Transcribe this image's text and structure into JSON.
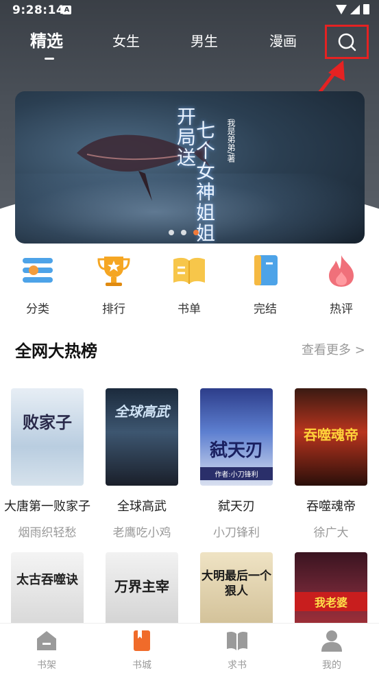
{
  "status": {
    "time": "9:28:14",
    "app_badge": "A"
  },
  "top_tabs": [
    {
      "label": "精选",
      "active": true
    },
    {
      "label": "女生",
      "active": false
    },
    {
      "label": "男生",
      "active": false
    },
    {
      "label": "漫画",
      "active": false
    }
  ],
  "banner": {
    "title_line1": "开局送",
    "title_line2": "七个女神姐姐",
    "author": "我是弟弟/著",
    "dot_count": 3,
    "active_dot": 2
  },
  "categories": [
    {
      "label": "分类",
      "icon": "category-icon"
    },
    {
      "label": "排行",
      "icon": "trophy-icon"
    },
    {
      "label": "书单",
      "icon": "booklist-icon"
    },
    {
      "label": "完结",
      "icon": "finished-book-icon"
    },
    {
      "label": "热评",
      "icon": "flame-icon"
    }
  ],
  "section": {
    "title": "全网大热榜",
    "more": "查看更多 >"
  },
  "books_row1": [
    {
      "title": "大唐第一败家子",
      "author": "烟雨织轻愁",
      "cover_text": "败家子"
    },
    {
      "title": "全球高武",
      "author": "老鹰吃小鸡",
      "cover_text": "全球高武"
    },
    {
      "title": "弑天刃",
      "author": "小刀锋利",
      "cover_text": "弑天刃",
      "cover_sub": "作者:小刀锋利"
    },
    {
      "title": "吞噬魂帝",
      "author": "徐广大",
      "cover_text": "吞噬魂帝"
    }
  ],
  "books_row2": [
    {
      "cover_text": "太古吞噬诀"
    },
    {
      "cover_text": "万界主宰"
    },
    {
      "cover_text": "大明最后一个狠人"
    },
    {
      "cover_text": "我老婆"
    }
  ],
  "bottom_nav": [
    {
      "label": "书架",
      "icon": "bookshelf-icon",
      "active": false
    },
    {
      "label": "书城",
      "icon": "bookstore-icon",
      "active": true
    },
    {
      "label": "求书",
      "icon": "request-book-icon",
      "active": false
    },
    {
      "label": "我的",
      "icon": "profile-icon",
      "active": false
    }
  ],
  "colors": {
    "accent": "#f06b2a",
    "highlight_box": "#e52222"
  }
}
